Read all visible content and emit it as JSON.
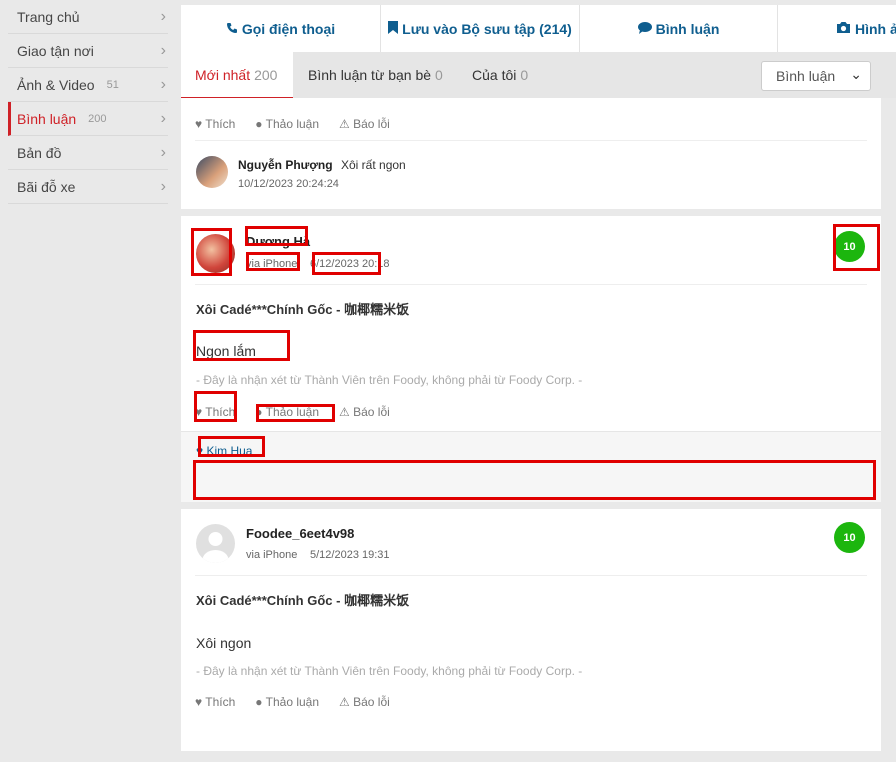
{
  "sidebar": {
    "items": [
      {
        "label": "Trang chủ",
        "count": ""
      },
      {
        "label": "Giao tận nơi",
        "count": ""
      },
      {
        "label": "Ảnh & Video",
        "count": "51"
      },
      {
        "label": "Bình luận",
        "count": "200"
      },
      {
        "label": "Bản đồ",
        "count": ""
      },
      {
        "label": "Bãi đỗ xe",
        "count": ""
      }
    ]
  },
  "topbar": {
    "call": "Gọi điện thoại",
    "save": "Lưu vào Bộ sưu tập (214)",
    "comment": "Bình luận",
    "photo": "Hình ả"
  },
  "tabs": {
    "newest": {
      "label": "Mới nhất",
      "count": "200"
    },
    "friends": {
      "label": "Bình luận từ bạn bè",
      "count": "0"
    },
    "mine": {
      "label": "Của tôi",
      "count": "0"
    },
    "sort": "Bình luận"
  },
  "actions": {
    "like": "Thích",
    "discuss": "Thảo luận",
    "report": "Báo lỗi"
  },
  "card1": {
    "reply_name": "Nguyễn Phượng",
    "reply_text": "Xôi rất ngon",
    "reply_time": "10/12/2023 20:24:24"
  },
  "card2": {
    "name": "Dương Hà",
    "via": "via iPhone",
    "time": "6/12/2023 20:18",
    "score": "10",
    "title": "Xôi Cadé***Chính Gốc - 咖椰糯米饭",
    "body": "Ngon lắm",
    "disclaimer": "- Đây là nhận xét từ Thành Viên trên Foody, không phải từ Foody Corp. -",
    "liker": "Kim Hua"
  },
  "card3": {
    "name": "Foodee_6eet4v98",
    "via": "via iPhone",
    "time": "5/12/2023 19:31",
    "score": "10",
    "title": "Xôi Cadé***Chính Gốc - 咖椰糯米饭",
    "body": "Xôi ngon",
    "disclaimer": "- Đây là nhận xét từ Thành Viên trên Foody, không phải từ Foody Corp. -"
  },
  "icons": {
    "phone": "phone-icon",
    "bookmark": "bookmark-icon",
    "comment": "comment-icon",
    "camera": "camera-icon",
    "heart": "heart-icon",
    "chat": "chat-icon",
    "warning": "warning-icon",
    "chevron": "chevron-right-icon"
  },
  "colors": {
    "accent": "#cf2127",
    "link": "#0f5e8f",
    "score": "#1cb60e",
    "highlight": "#e00000"
  }
}
